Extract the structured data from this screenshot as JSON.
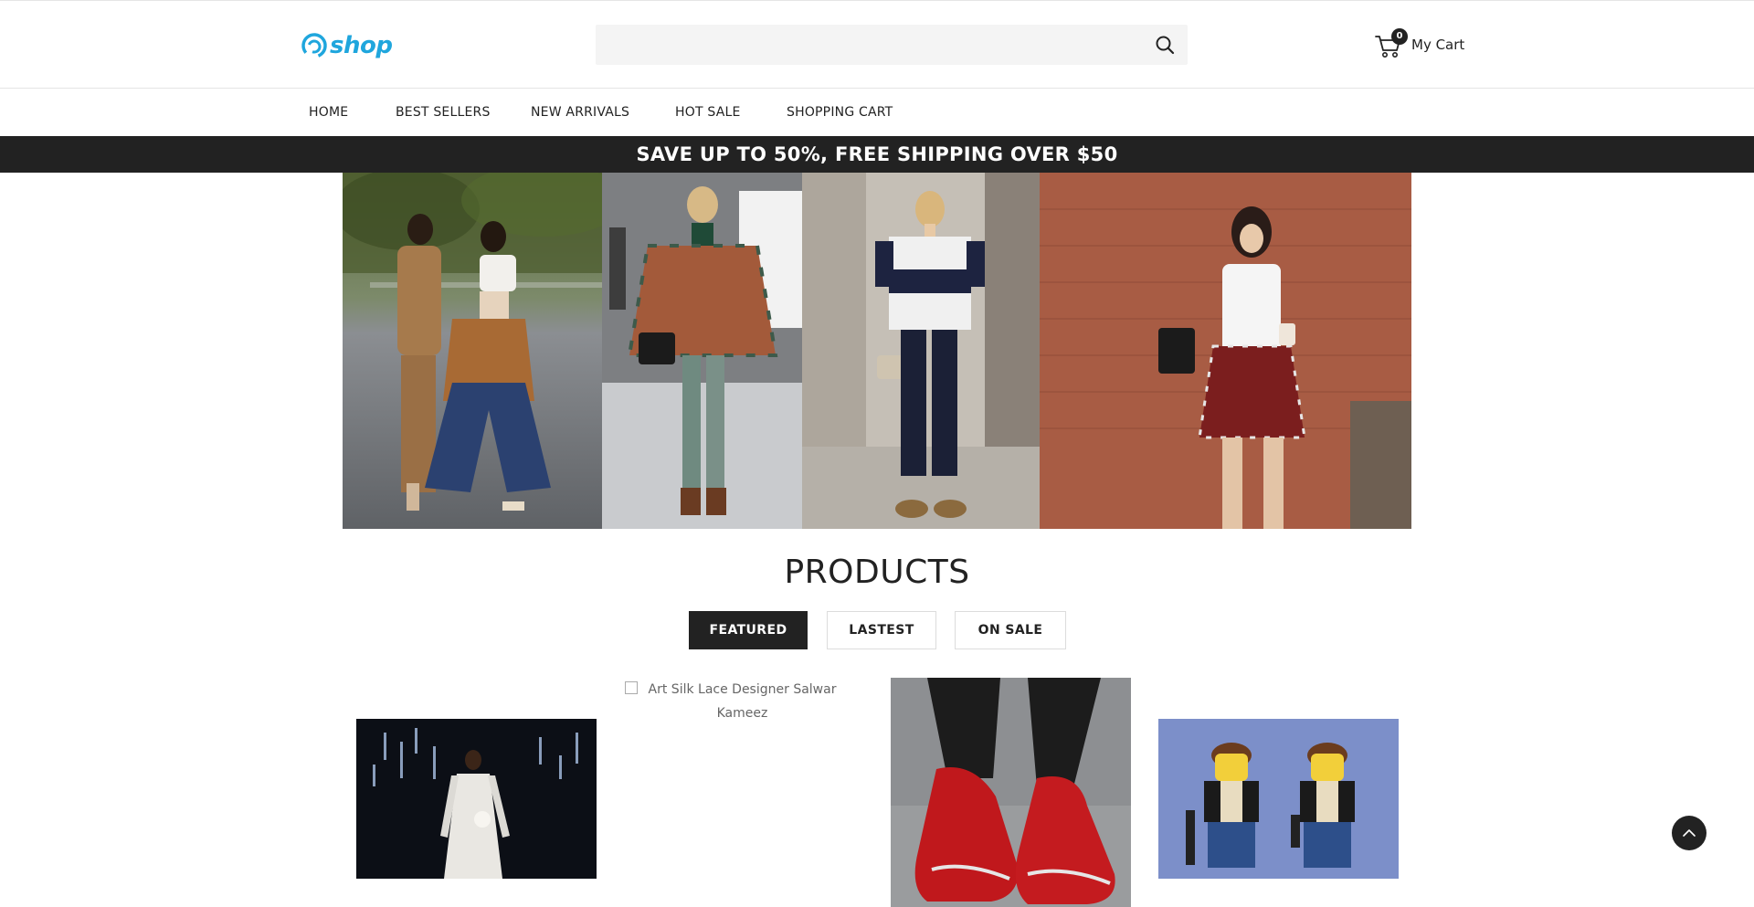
{
  "header": {
    "logo_text": "shop",
    "search": {
      "placeholder": ""
    },
    "cart": {
      "count": "0",
      "label": "My Cart"
    }
  },
  "nav": {
    "items": [
      {
        "label": "HOME"
      },
      {
        "label": "BEST SELLERS"
      },
      {
        "label": "NEW ARRIVALS"
      },
      {
        "label": "HOT SALE"
      },
      {
        "label": "SHOPPING CART"
      }
    ]
  },
  "promo": {
    "text": "SAVE UP TO 50%, FREE SHIPPING OVER $50"
  },
  "products": {
    "title": "PRODUCTS",
    "tabs": [
      {
        "label": "FEATURED",
        "active": true
      },
      {
        "label": "LASTEST",
        "active": false
      },
      {
        "label": "ON SALE",
        "active": false
      }
    ],
    "broken_image_alt": "Art Silk Lace Designer Salwar Kameez"
  },
  "colors": {
    "brand": "#1fa6dd",
    "dark": "#222222",
    "search_bg": "#f4f4f4"
  },
  "icons": {
    "search": "search-icon",
    "cart": "cart-icon",
    "back_to_top": "chevron-up-icon"
  }
}
